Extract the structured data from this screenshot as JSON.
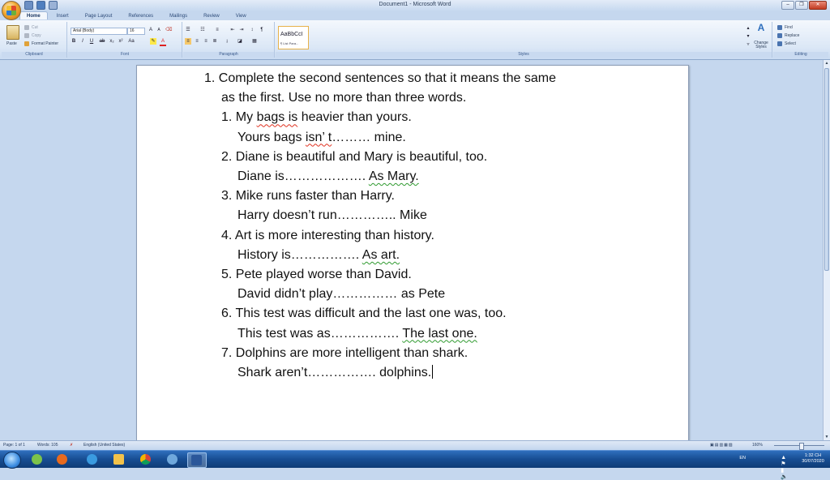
{
  "window": {
    "title": "Document1 - Microsoft Word",
    "minimize": "–",
    "restore": "❐",
    "close": "✕"
  },
  "tabs": [
    "Home",
    "Insert",
    "Page Layout",
    "References",
    "Mailings",
    "Review",
    "View"
  ],
  "ribbon": {
    "clipboard": {
      "label": "Clipboard",
      "paste": "Paste",
      "cut": "Cut",
      "copy": "Copy",
      "format_painter": "Format Painter"
    },
    "font": {
      "label": "Font",
      "font_name": "Arial (Body)",
      "font_size": "16"
    },
    "paragraph": {
      "label": "Paragraph"
    },
    "styles": {
      "label": "Styles",
      "sample": "AaBbCcI",
      "style_name": "¶ List Para...",
      "change_styles": "Change Styles"
    },
    "editing": {
      "label": "Editing",
      "find": "Find",
      "replace": "Replace",
      "select": "Select"
    }
  },
  "document": {
    "lines": [
      {
        "segments": [
          {
            "t": "1. Complete the second sentences so that it means the same"
          }
        ]
      },
      {
        "segments": [
          {
            "t": "as the first. Use no more than three words."
          }
        ]
      },
      {
        "segments": [
          {
            "t": "1. My "
          },
          {
            "t": "bags is",
            "sq": "red"
          },
          {
            "t": " heavier than yours."
          }
        ]
      },
      {
        "segments": [
          {
            "t": "Yours bags "
          },
          {
            "t": "isn’ t",
            "sq": "red"
          },
          {
            "t": "……… mine."
          }
        ]
      },
      {
        "segments": [
          {
            "t": "2. Diane is beautiful and Mary is beautiful, too."
          }
        ]
      },
      {
        "segments": [
          {
            "t": "Diane is………………. "
          },
          {
            "t": "As Mary.",
            "sq": "green"
          }
        ]
      },
      {
        "segments": [
          {
            "t": "3. Mike runs faster than Harry."
          }
        ]
      },
      {
        "segments": [
          {
            "t": "Harry doesn’t run………….. Mike"
          }
        ]
      },
      {
        "segments": [
          {
            "t": "4. Art is more interesting than history."
          }
        ]
      },
      {
        "segments": [
          {
            "t": "History is……………. "
          },
          {
            "t": "As art.",
            "sq": "green"
          }
        ]
      },
      {
        "segments": [
          {
            "t": "5. Pete played worse than David."
          }
        ]
      },
      {
        "segments": [
          {
            "t": "David didn’t play……………  as Pete"
          }
        ]
      },
      {
        "segments": [
          {
            "t": "6. This test was difficult and the last one was, too."
          }
        ]
      },
      {
        "segments": [
          {
            "t": "This test was as……………. "
          },
          {
            "t": "The last one.",
            "sq": "green"
          }
        ]
      },
      {
        "segments": [
          {
            "t": "7. Dolphins are more intelligent than shark."
          }
        ]
      },
      {
        "segments": [
          {
            "t": "Shark aren’t……………. dolphins."
          }
        ]
      }
    ]
  },
  "status": {
    "page": "Page: 1 of 1",
    "words": "Words: 105",
    "language": "English (United States)",
    "zoom": "160%"
  },
  "taskbar": {
    "language": "EN",
    "time": "1:32 CH",
    "date": "30/07/2020"
  },
  "colors": {
    "accent": "#2c4a78",
    "taskbar": "#174d92",
    "spell_error": "#e0301e",
    "grammar_error": "#2f9a2f"
  }
}
